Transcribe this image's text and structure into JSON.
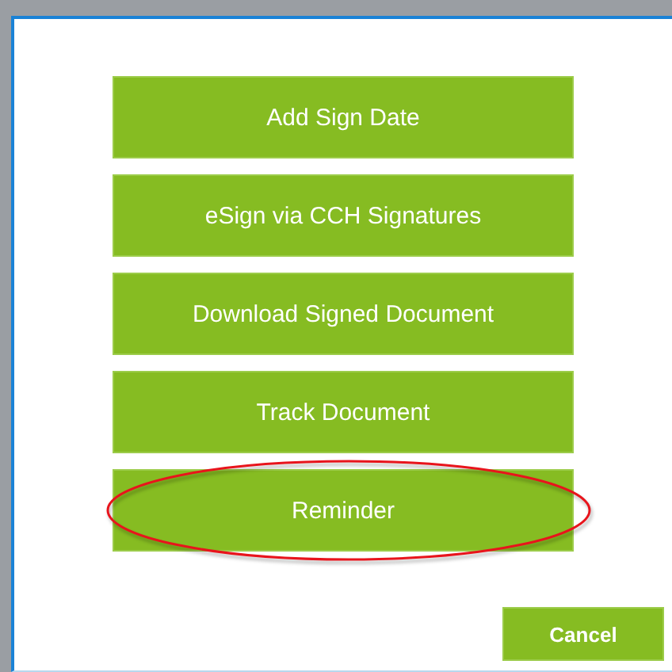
{
  "actions": [
    {
      "label": "Add Sign Date",
      "highlighted": false
    },
    {
      "label": "eSign via CCH Signatures",
      "highlighted": false
    },
    {
      "label": "Download Signed Document",
      "highlighted": false
    },
    {
      "label": "Track Document",
      "highlighted": false
    },
    {
      "label": "Reminder",
      "highlighted": true
    }
  ],
  "cancel_button": "Cancel"
}
